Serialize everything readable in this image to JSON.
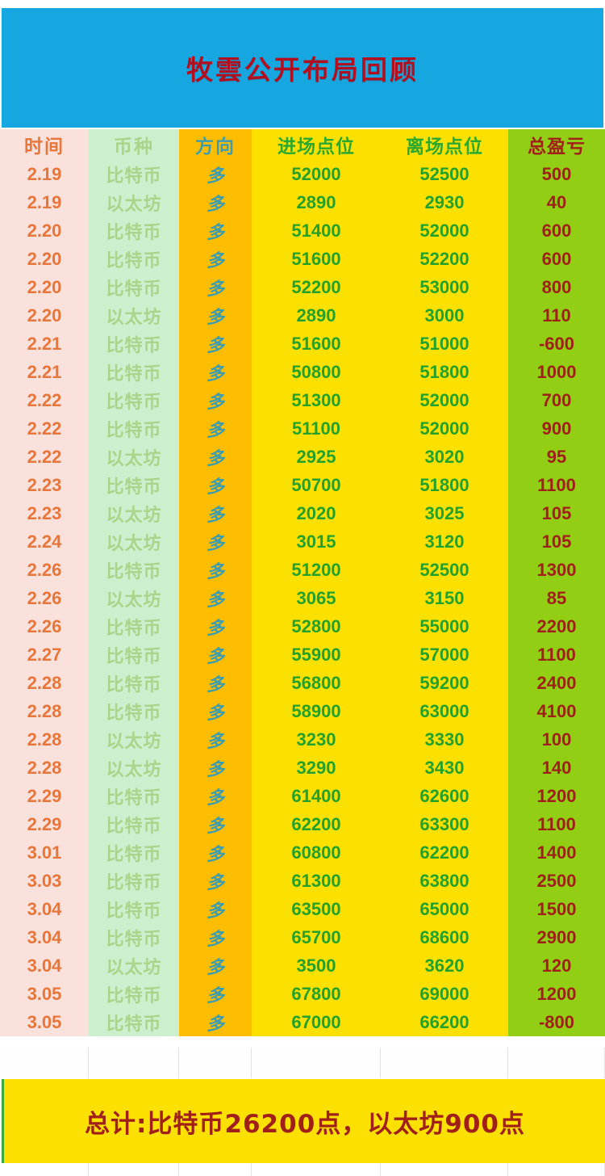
{
  "title": {
    "text": "牧雲公开布局回顾",
    "banner_color": "#17A7E0",
    "text_color": "#B01020"
  },
  "table": {
    "columns": [
      {
        "key": "time",
        "label": "时间",
        "bg": "#FBE1DC",
        "fg": "#E8763A"
      },
      {
        "key": "coin",
        "label": "币种",
        "bg": "#CCF0CE",
        "fg": "#A9D48A"
      },
      {
        "key": "dir",
        "label": "方向",
        "bg": "#FFBD00",
        "fg": "#3C9DB0"
      },
      {
        "key": "entry",
        "label": "进场点位",
        "bg": "#FCE000",
        "fg": "#23A12A"
      },
      {
        "key": "exit",
        "label": "离场点位",
        "bg": "#FCE000",
        "fg": "#23A12A"
      },
      {
        "key": "pnl",
        "label": "总盈亏",
        "bg": "#91CE14",
        "fg": "#A02018"
      }
    ],
    "rows": [
      {
        "time": "2.19",
        "coin": "比特币",
        "dir": "多",
        "entry": "52000",
        "exit": "52500",
        "pnl": "500"
      },
      {
        "time": "2.19",
        "coin": "以太坊",
        "dir": "多",
        "entry": "2890",
        "exit": "2930",
        "pnl": "40"
      },
      {
        "time": "2.20",
        "coin": "比特币",
        "dir": "多",
        "entry": "51400",
        "exit": "52000",
        "pnl": "600"
      },
      {
        "time": "2.20",
        "coin": "比特币",
        "dir": "多",
        "entry": "51600",
        "exit": "52200",
        "pnl": "600"
      },
      {
        "time": "2.20",
        "coin": "比特币",
        "dir": "多",
        "entry": "52200",
        "exit": "53000",
        "pnl": "800"
      },
      {
        "time": "2.20",
        "coin": "以太坊",
        "dir": "多",
        "entry": "2890",
        "exit": "3000",
        "pnl": "110"
      },
      {
        "time": "2.21",
        "coin": "比特币",
        "dir": "多",
        "entry": "51600",
        "exit": "51000",
        "pnl": "-600"
      },
      {
        "time": "2.21",
        "coin": "比特币",
        "dir": "多",
        "entry": "50800",
        "exit": "51800",
        "pnl": "1000"
      },
      {
        "time": "2.22",
        "coin": "比特币",
        "dir": "多",
        "entry": "51300",
        "exit": "52000",
        "pnl": "700"
      },
      {
        "time": "2.22",
        "coin": "比特币",
        "dir": "多",
        "entry": "51100",
        "exit": "52000",
        "pnl": "900"
      },
      {
        "time": "2.22",
        "coin": "以太坊",
        "dir": "多",
        "entry": "2925",
        "exit": "3020",
        "pnl": "95"
      },
      {
        "time": "2.23",
        "coin": "比特币",
        "dir": "多",
        "entry": "50700",
        "exit": "51800",
        "pnl": "1100"
      },
      {
        "time": "2.23",
        "coin": "以太坊",
        "dir": "多",
        "entry": "2020",
        "exit": "3025",
        "pnl": "105"
      },
      {
        "time": "2.24",
        "coin": "以太坊",
        "dir": "多",
        "entry": "3015",
        "exit": "3120",
        "pnl": "105"
      },
      {
        "time": "2.26",
        "coin": "比特币",
        "dir": "多",
        "entry": "51200",
        "exit": "52500",
        "pnl": "1300"
      },
      {
        "time": "2.26",
        "coin": "以太坊",
        "dir": "多",
        "entry": "3065",
        "exit": "3150",
        "pnl": "85"
      },
      {
        "time": "2.26",
        "coin": "比特币",
        "dir": "多",
        "entry": "52800",
        "exit": "55000",
        "pnl": "2200"
      },
      {
        "time": "2.27",
        "coin": "比特币",
        "dir": "多",
        "entry": "55900",
        "exit": "57000",
        "pnl": "1100"
      },
      {
        "time": "2.28",
        "coin": "比特币",
        "dir": "多",
        "entry": "56800",
        "exit": "59200",
        "pnl": "2400"
      },
      {
        "time": "2.28",
        "coin": "比特币",
        "dir": "多",
        "entry": "58900",
        "exit": "63000",
        "pnl": "4100"
      },
      {
        "time": "2.28",
        "coin": "以太坊",
        "dir": "多",
        "entry": "3230",
        "exit": "3330",
        "pnl": "100"
      },
      {
        "time": "2.28",
        "coin": "以太坊",
        "dir": "多",
        "entry": "3290",
        "exit": "3430",
        "pnl": "140"
      },
      {
        "time": "2.29",
        "coin": "比特币",
        "dir": "多",
        "entry": "61400",
        "exit": "62600",
        "pnl": "1200"
      },
      {
        "time": "2.29",
        "coin": "比特币",
        "dir": "多",
        "entry": "62200",
        "exit": "63300",
        "pnl": "1100"
      },
      {
        "time": "3.01",
        "coin": "比特币",
        "dir": "多",
        "entry": "60800",
        "exit": "62200",
        "pnl": "1400"
      },
      {
        "time": "3.03",
        "coin": "比特币",
        "dir": "多",
        "entry": "61300",
        "exit": "63800",
        "pnl": "2500"
      },
      {
        "time": "3.04",
        "coin": "比特币",
        "dir": "多",
        "entry": "63500",
        "exit": "65000",
        "pnl": "1500"
      },
      {
        "time": "3.04",
        "coin": "比特币",
        "dir": "多",
        "entry": "65700",
        "exit": "68600",
        "pnl": "2900"
      },
      {
        "time": "3.04",
        "coin": "以太坊",
        "dir": "多",
        "entry": "3500",
        "exit": "3620",
        "pnl": "120"
      },
      {
        "time": "3.05",
        "coin": "比特币",
        "dir": "多",
        "entry": "67800",
        "exit": "69000",
        "pnl": "1200"
      },
      {
        "time": "3.05",
        "coin": "比特币",
        "dir": "多",
        "entry": "67000",
        "exit": "66200",
        "pnl": "-800"
      }
    ]
  },
  "footer": {
    "text": "总计:比特币26200点，以太坊900点",
    "bg": "#FCE000",
    "fg": "#A02018"
  }
}
